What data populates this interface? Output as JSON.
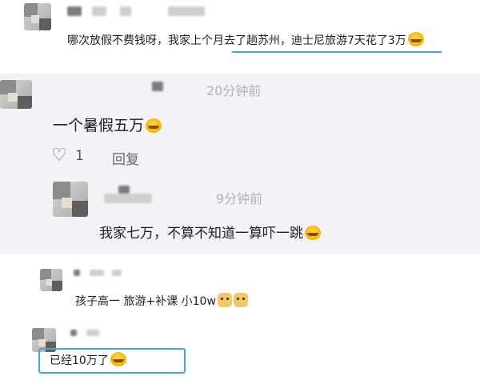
{
  "comment1": {
    "text": "哪次放假不费钱呀，我家上个月去了趟苏州，迪士尼旅游7天花了3万",
    "emoji": "laugh-cry-emoji"
  },
  "comment2": {
    "time": "20分钟前",
    "text": "一个暑假五万",
    "emoji": "laugh-cry-emoji",
    "like_count": "1",
    "reply_label": "回复"
  },
  "reply1": {
    "time": "9分钟前",
    "text": "我家七万，不算不知道一算吓一跳",
    "emoji": "laugh-cry-emoji"
  },
  "comment3": {
    "text": "孩子高一 旅游+补课 小10w",
    "emoji": "cat-laugh-emoji"
  },
  "comment4": {
    "text": "已经10万了",
    "emoji": "laugh-cry-emoji"
  },
  "colors": {
    "highlight": "#49a3e0",
    "thread_bg": "#f2f2f7",
    "timestamp": "#b3b3b3"
  }
}
